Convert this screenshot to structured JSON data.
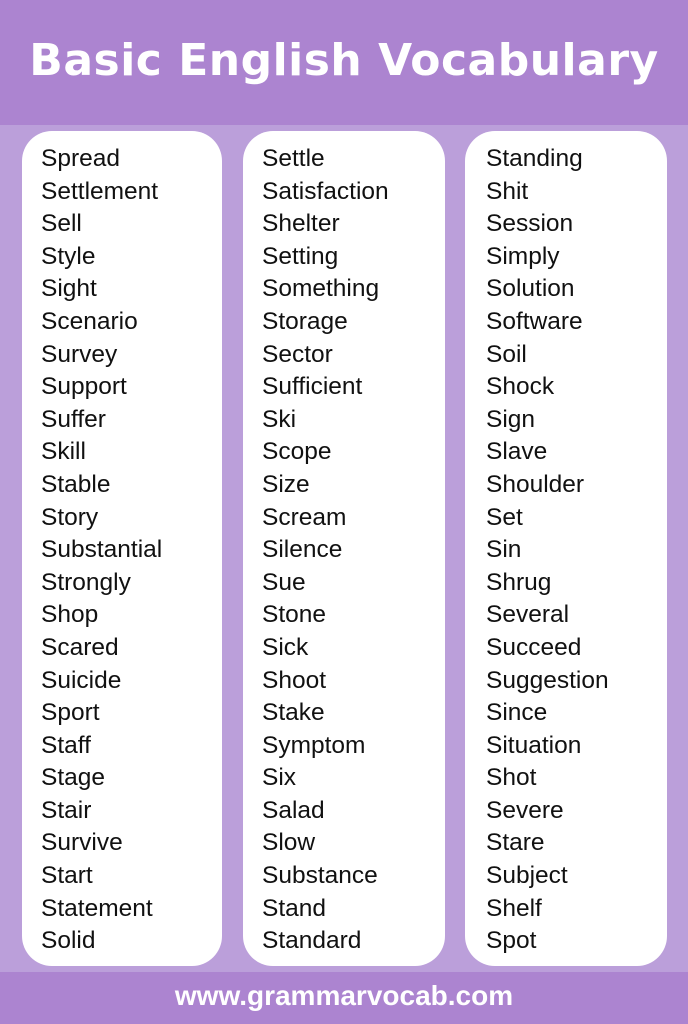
{
  "header": {
    "title": "Basic English Vocabulary"
  },
  "columns": [
    [
      "Spread",
      "Settlement",
      "Sell",
      "Style",
      "Sight",
      "Scenario",
      "Survey",
      "Support",
      "Suffer",
      "Skill",
      "Stable",
      "Story",
      "Substantial",
      "Strongly",
      "Shop",
      "Scared",
      "Suicide",
      "Sport",
      "Staff",
      "Stage",
      "Stair",
      "Survive",
      "Start",
      "Statement",
      "Solid"
    ],
    [
      "Settle",
      "Satisfaction",
      "Shelter",
      "Setting",
      "Something",
      "Storage",
      "Sector",
      "Sufficient",
      "Ski",
      "Scope",
      "Size",
      "Scream",
      "Silence",
      "Sue",
      "Stone",
      "Sick",
      "Shoot",
      "Stake",
      "Symptom",
      "Six",
      "Salad",
      "Slow",
      "Substance",
      "Stand",
      "Standard"
    ],
    [
      "Standing",
      "Shit",
      "Session",
      "Simply",
      "Solution",
      "Software",
      "Soil",
      "Shock",
      "Sign",
      "Slave",
      "Shoulder",
      "Set",
      "Sin",
      "Shrug",
      "Several",
      "Succeed",
      "Suggestion",
      "Since",
      "Situation",
      "Shot",
      "Severe",
      "Stare",
      "Subject",
      "Shelf",
      "Spot"
    ]
  ],
  "footer": {
    "url": "www.grammarvocab.com"
  },
  "colors": {
    "header": "#ac84d0",
    "background": "#bb9fda",
    "panel": "#ffffff"
  }
}
